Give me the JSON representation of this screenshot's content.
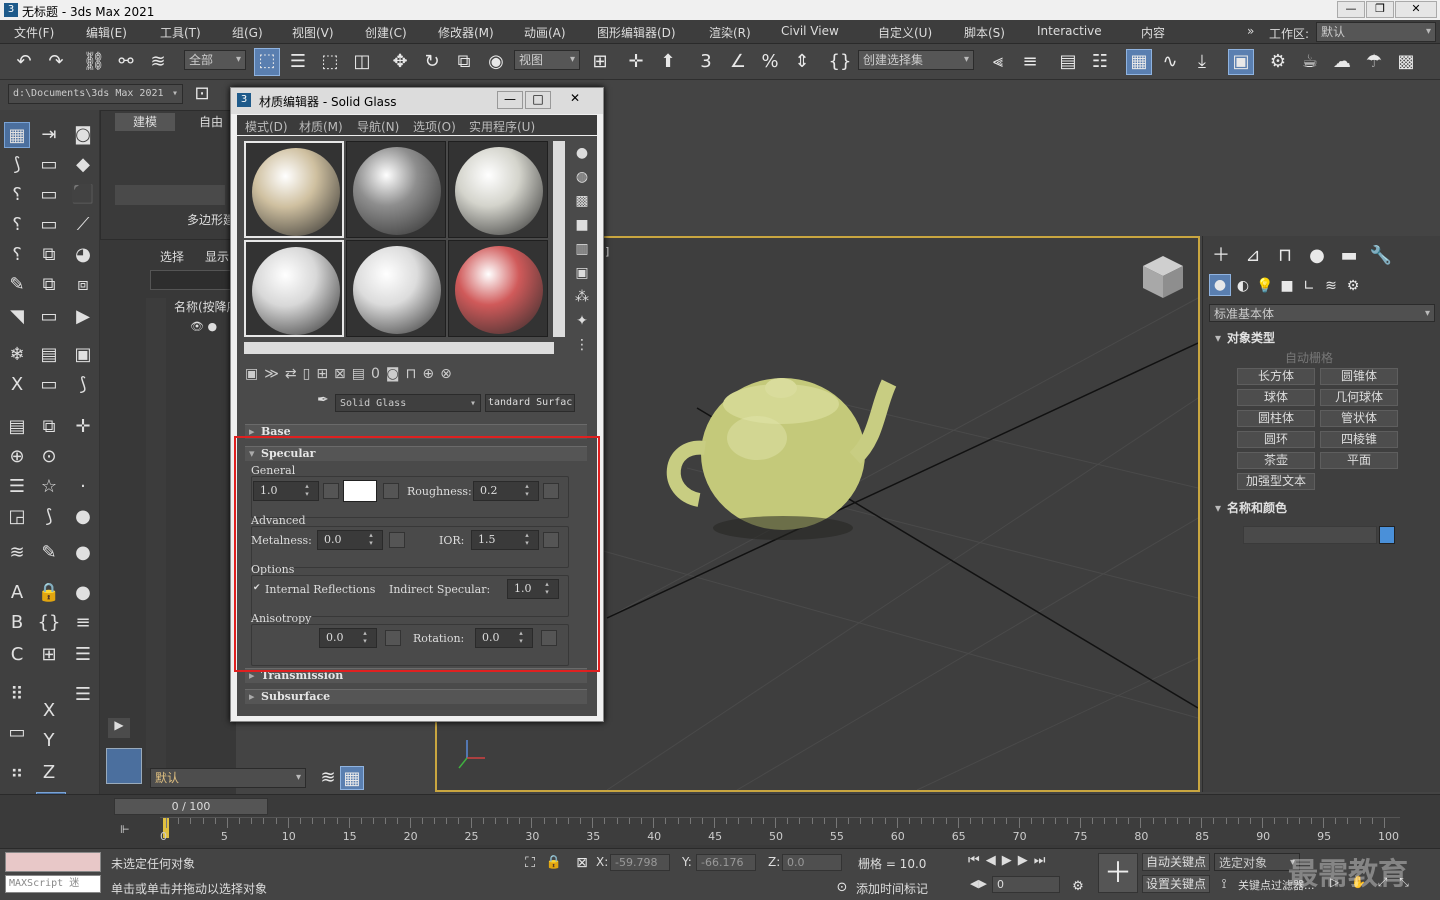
{
  "window": {
    "title": "无标题 - 3ds Max 2021",
    "min": "—",
    "restore": "❐",
    "close": "✕"
  },
  "menu": [
    "文件(F)",
    "编辑(E)",
    "工具(T)",
    "组(G)",
    "视图(V)",
    "创建(C)",
    "修改器(M)",
    "动画(A)",
    "图形编辑器(D)",
    "渲染(R)",
    "Civil View",
    "自定义(U)",
    "脚本(S)",
    "Interactive",
    "内容"
  ],
  "workspace": {
    "label": "工作区:",
    "value": "默认"
  },
  "toolbar": {
    "filter": "全部",
    "view": "视图",
    "selection_set": "创建选择集"
  },
  "path": "d:\\Documents\\3ds Max 2021",
  "ribbon": {
    "tab_active": "建模",
    "tab2": "自由",
    "poly_label": "多边形建"
  },
  "scene": {
    "tab_select": "选择",
    "tab_display": "显示",
    "name_header": "名称(按降序"
  },
  "layer": "默认",
  "mat": {
    "title": "材质编辑器 - Solid Glass",
    "menu": [
      "模式(D)",
      "材质(M)",
      "导航(N)",
      "选项(O)",
      "实用程序(U)"
    ],
    "name": "Solid Glass",
    "type": "tandard Surfac",
    "rollouts": {
      "base": "Base",
      "specular": "Specular",
      "transmission": "Transmission",
      "subsurface": "Subsurface"
    },
    "general": {
      "label": "General",
      "weight": "1.0",
      "roughness_label": "Roughness:",
      "roughness": "0.2"
    },
    "advanced": {
      "label": "Advanced",
      "metalness_label": "Metalness:",
      "metalness": "0.0",
      "ior_label": "IOR:",
      "ior": "1.5"
    },
    "options": {
      "label": "Options",
      "check": "✔",
      "internal": "Internal Reflections",
      "indirect_label": "Indirect Specular:",
      "indirect": "1.0"
    },
    "anisotropy": {
      "label": "Anisotropy",
      "value": "0.0",
      "rotation_label": "Rotation:",
      "rotation": "0.0"
    },
    "slot_colors": [
      "#cfc0a0",
      "#8e8e8e",
      "#d4d4cc",
      "#d8d8d8",
      "#dcdcdc",
      "#d05a5a"
    ]
  },
  "cmd": {
    "category": "标准基本体",
    "object_type": "对象类型",
    "autogrid": "自动栅格",
    "buttons": [
      "长方体",
      "圆锥体",
      "球体",
      "几何球体",
      "圆柱体",
      "管状体",
      "圆环",
      "四棱锥",
      "茶壶",
      "平面",
      "加强型文本"
    ],
    "name_color": "名称和颜色",
    "swatch": "#4a90d9"
  },
  "timeline": {
    "frame": "0 / 100",
    "ticks": [
      "0",
      "5",
      "10",
      "15",
      "20",
      "25",
      "30",
      "35",
      "40",
      "45",
      "50",
      "55",
      "60",
      "65",
      "70",
      "75",
      "80",
      "85",
      "90",
      "95",
      "100"
    ]
  },
  "status": {
    "maxscript": "MAXScript 迷",
    "msg1": "未选定任何对象",
    "msg2": "单击或单击并拖动以选择对象",
    "x_label": "X:",
    "x": "-59.798",
    "y_label": "Y:",
    "y": "-66.176",
    "z_label": "Z:",
    "z": "0.0",
    "grid": "栅格 = 10.0",
    "add_tag": "添加时间标记",
    "autokey": "自动关键点",
    "selected": "选定对象",
    "setkey": "设置关键点",
    "keyfilter": "关键点过滤器...",
    "frame": "0",
    "watermark": "最需教育"
  },
  "viewport_label": "]"
}
